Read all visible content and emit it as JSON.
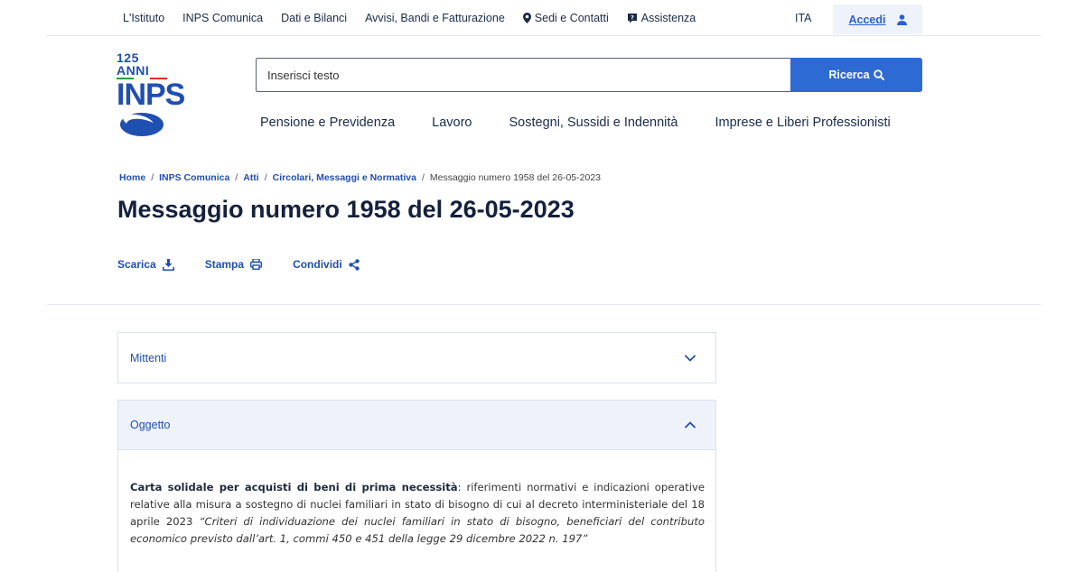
{
  "topnav": {
    "items": [
      "L'Istituto",
      "INPS Comunica",
      "Dati e Bilanci",
      "Avvisi, Bandi e Fatturazione",
      "Sedi e Contatti",
      "Assistenza"
    ],
    "lang": "ITA",
    "login_label": "Accedi"
  },
  "logo": {
    "anni": "125 ANNI",
    "name": "INPS"
  },
  "search": {
    "placeholder": "Inserisci testo",
    "button_label": "Ricerca"
  },
  "mainnav": [
    "Pensione e Previdenza",
    "Lavoro",
    "Sostegni, Sussidi e Indennità",
    "Imprese e Liberi Professionisti"
  ],
  "breadcrumb": [
    "Home",
    "INPS Comunica",
    "Atti",
    "Circolari, Messaggi e Normativa"
  ],
  "breadcrumb_current": "Messaggio numero 1958 del 26-05-2023",
  "page_title": "Messaggio numero 1958 del 26-05-2023",
  "actions": {
    "download": "Scarica",
    "print": "Stampa",
    "share": "Condividi"
  },
  "accordions": {
    "mittenti": "Mittenti",
    "oggetto": "Oggetto"
  },
  "oggetto_text": {
    "bold": "Carta solidale per acquisti di beni di prima necessità",
    "normal": ": riferimenti normativi e indicazioni operative relative alla misura a sostegno di nuclei familiari in stato di bisogno di cui al decreto interministeriale del 18 aprile 2023 ",
    "italic": "“Criteri di individuazione dei nuclei familiari in stato di bisogno, beneficiari del contributo economico previsto dall’art. 1, commi 450 e 451 della legge 29 dicembre 2022 n. 197”"
  },
  "colors": {
    "primary": "#2e6ad4",
    "link": "#1f4fb0",
    "title": "#14213d",
    "accordion_bg": "#eef2fa"
  }
}
